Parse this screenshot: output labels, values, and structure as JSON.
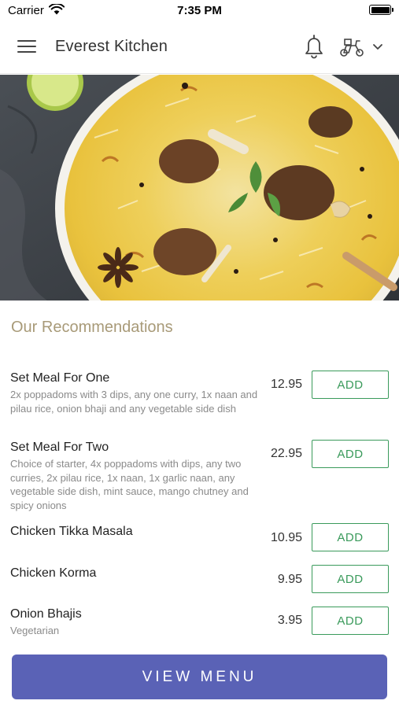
{
  "status_bar": {
    "carrier": "Carrier",
    "time": "7:35 PM",
    "icons": [
      "wifi-icon",
      "battery-icon"
    ]
  },
  "header": {
    "title": "Everest Kitchen",
    "icons": [
      "menu-icon",
      "bell-icon",
      "delivery-scooter-icon",
      "chevron-down-icon"
    ]
  },
  "hero": {
    "image": "biryani-bowl-photo"
  },
  "recommendations": {
    "title": "Our Recommendations",
    "add_label": "ADD",
    "items": [
      {
        "name": "Set Meal For One",
        "description": "2x poppadoms with 3 dips, any one curry, 1x naan and pilau rice, onion bhaji and any vegetable side dish",
        "price": "12.95"
      },
      {
        "name": "Set Meal For Two",
        "description": "Choice of starter, 4x poppadoms with dips, any two curries, 2x pilau rice, 1x naan, 1x garlic naan, any vegetable side dish, mint sauce, mango chutney and spicy onions",
        "price": "22.95"
      },
      {
        "name": "Chicken Tikka Masala",
        "description": "",
        "price": "10.95"
      },
      {
        "name": "Chicken Korma",
        "description": "",
        "price": "9.95"
      },
      {
        "name": "Onion Bhajis",
        "description": "Vegetarian",
        "price": "3.95"
      }
    ]
  },
  "footer": {
    "view_menu_label": "VIEW MENU"
  },
  "colors": {
    "accent_green": "#3a9a5b",
    "primary_button": "#5a62b6",
    "section_title": "#a89a78"
  }
}
